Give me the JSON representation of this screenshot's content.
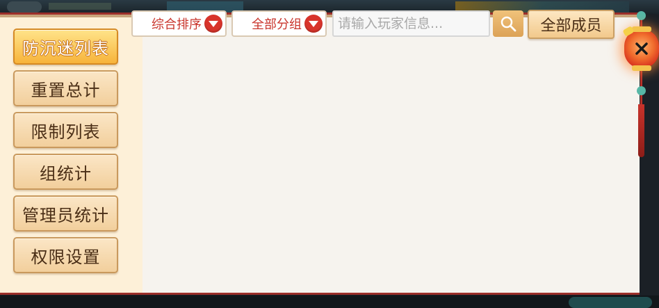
{
  "sidebar": {
    "items": [
      {
        "label": "防沉迷列表",
        "active": true
      },
      {
        "label": "重置总计",
        "active": false
      },
      {
        "label": "限制列表",
        "active": false
      },
      {
        "label": "组统计",
        "active": false
      },
      {
        "label": "管理员统计",
        "active": false
      },
      {
        "label": "权限设置",
        "active": false
      }
    ]
  },
  "toolbar": {
    "sort_dropdown": "综合排序",
    "group_dropdown": "全部分组",
    "search_placeholder": "请输入玩家信息...",
    "search_value": "",
    "all_members_label": "全部成员"
  },
  "colors": {
    "accent_red": "#d8342b",
    "active_menu": "#f7b43b",
    "frame_red": "#9c2f2a",
    "panel_bg": "#f6f3ee"
  },
  "icons": {
    "search": "search-icon",
    "dropdown": "chevron-down-icon",
    "close": "close-icon"
  }
}
